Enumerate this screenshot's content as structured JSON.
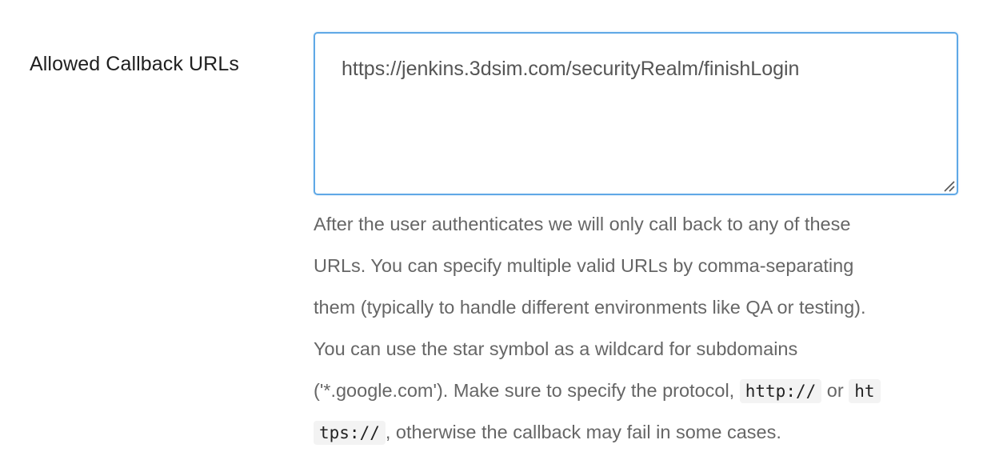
{
  "field": {
    "label": "Allowed Callback URLs",
    "value": "https://jenkins.3dsim.com/securityRealm/finishLogin"
  },
  "help": {
    "line1": "After the user authenticates we will only call back to any of these",
    "line2": "URLs. You can specify multiple valid URLs by comma-separating",
    "line3": "them (typically to handle different environments like QA or testing).",
    "line4": "You can use the star symbol as a wildcard for subdomains",
    "line5_prefix": "('*.google.com'). Make sure to specify the protocol,",
    "code1": "http://",
    "or_text": "or",
    "code2_part1": "ht",
    "code2_part2": "tps://",
    "line6_suffix": ", otherwise the callback may fail in some cases."
  },
  "colors": {
    "focus_border": "#5fa8e6",
    "label": "#1f1f1f",
    "help_text": "#666666"
  }
}
